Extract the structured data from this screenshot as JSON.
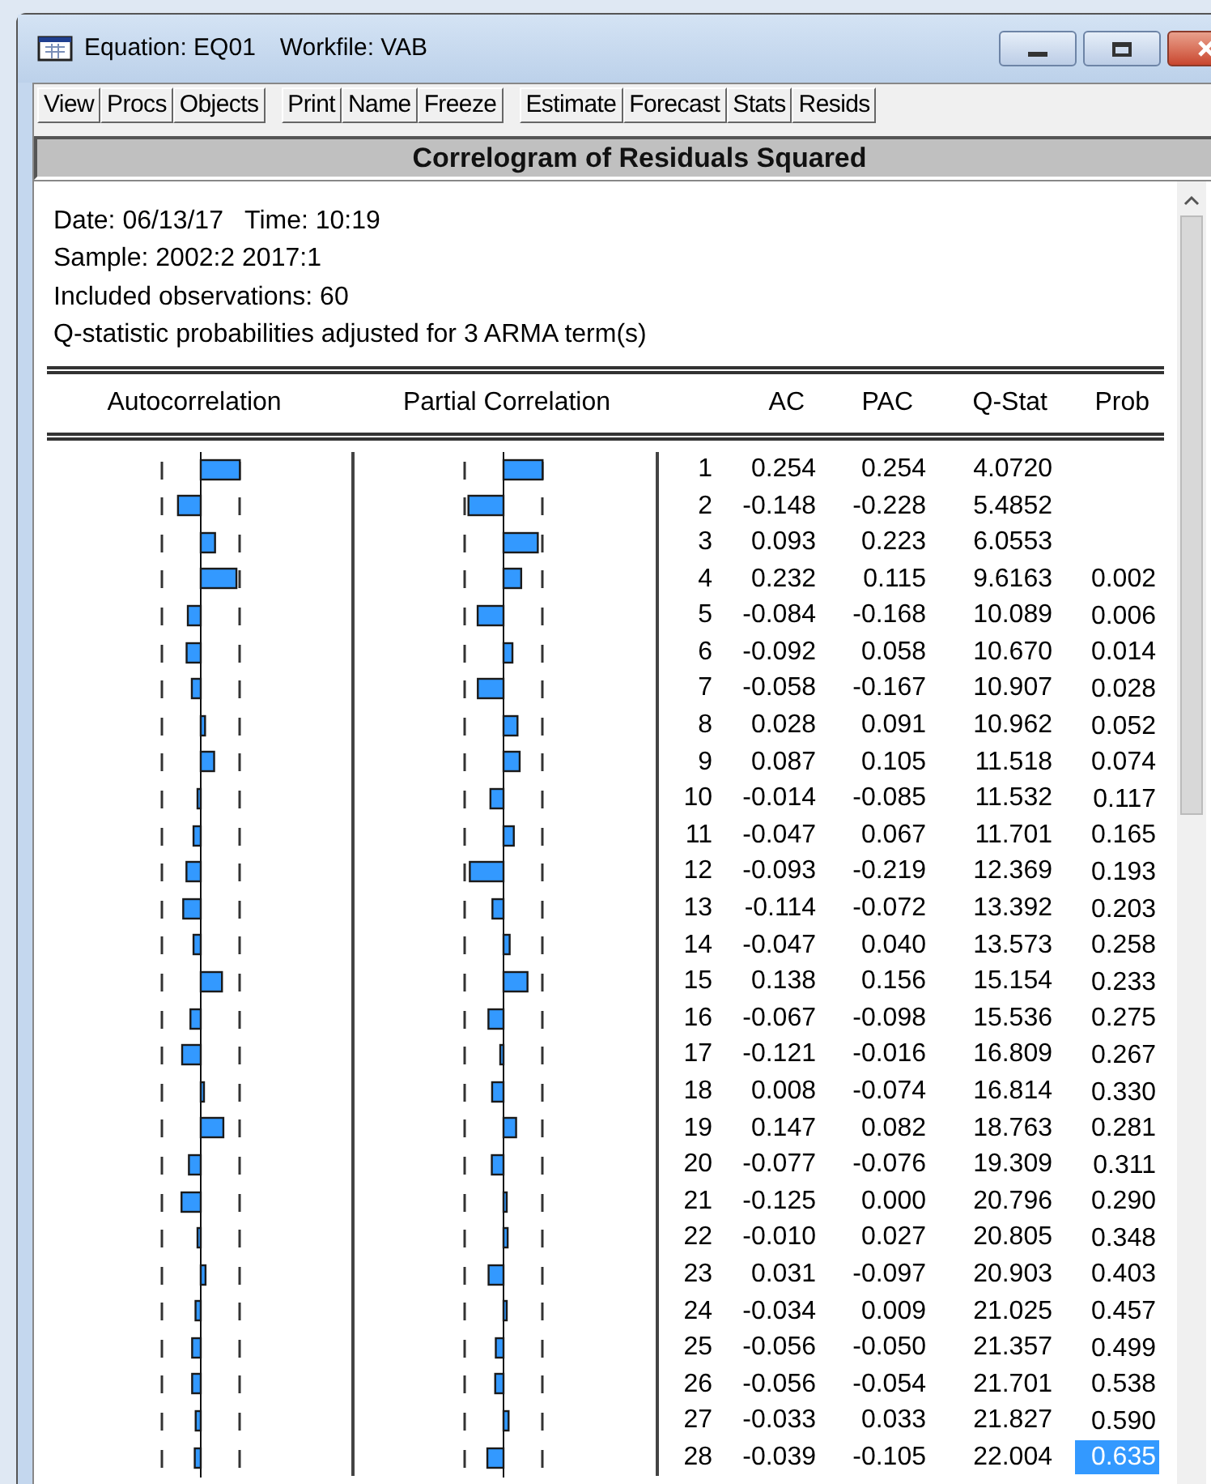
{
  "window": {
    "title": "Equation: EQ01",
    "workfile": "Workfile: VAB"
  },
  "toolbar_groups": [
    {
      "buttons": [
        "View",
        "Procs",
        "Objects"
      ]
    },
    {
      "buttons": [
        "Print",
        "Name",
        "Freeze"
      ]
    },
    {
      "buttons": [
        "Estimate",
        "Forecast",
        "Stats",
        "Resids"
      ]
    }
  ],
  "view_title": "Correlogram of Residuals Squared",
  "info_lines": [
    "Date: 06/13/17   Time: 10:19",
    "Sample: 2002:2 2017:1",
    "Included observations: 60",
    "Q-statistic probabilities adjusted for 3 ARMA term(s)"
  ],
  "columns": [
    "Autocorrelation",
    "Partial Correlation",
    "AC",
    "PAC",
    "Q-Stat",
    "Prob"
  ],
  "rows": [
    {
      "lag": "1",
      "ac": "0.254",
      "pac": "0.254",
      "q_stat": "4.0720",
      "selected": false
    },
    {
      "lag": "2",
      "ac": "-0.148",
      "pac": "-0.228",
      "q_stat": "5.4852",
      "selected": false
    },
    {
      "lag": "3",
      "ac": "0.093",
      "pac": "0.223",
      "q_stat": "6.0553",
      "selected": false
    },
    {
      "lag": "4",
      "ac": "0.232",
      "pac": "0.115",
      "q_stat": "9.6163",
      "prob": "0.002",
      "selected": false
    },
    {
      "lag": "5",
      "ac": "-0.084",
      "pac": "-0.168",
      "q_stat": "10.089",
      "prob": "0.006",
      "selected": false
    },
    {
      "lag": "6",
      "ac": "-0.092",
      "pac": "0.058",
      "q_stat": "10.670",
      "prob": "0.014",
      "selected": false
    },
    {
      "lag": "7",
      "ac": "-0.058",
      "pac": "-0.167",
      "q_stat": "10.907",
      "prob": "0.028",
      "selected": false
    },
    {
      "lag": "8",
      "ac": "0.028",
      "pac": "0.091",
      "q_stat": "10.962",
      "prob": "0.052",
      "selected": false
    },
    {
      "lag": "9",
      "ac": "0.087",
      "pac": "0.105",
      "q_stat": "11.518",
      "prob": "0.074",
      "selected": false
    },
    {
      "lag": "10",
      "ac": "-0.014",
      "pac": "-0.085",
      "q_stat": "11.532",
      "prob": "0.117",
      "selected": false
    },
    {
      "lag": "11",
      "ac": "-0.047",
      "pac": "0.067",
      "q_stat": "11.701",
      "prob": "0.165",
      "selected": false
    },
    {
      "lag": "12",
      "ac": "-0.093",
      "pac": "-0.219",
      "q_stat": "12.369",
      "prob": "0.193",
      "selected": false
    },
    {
      "lag": "13",
      "ac": "-0.114",
      "pac": "-0.072",
      "q_stat": "13.392",
      "prob": "0.203",
      "selected": false
    },
    {
      "lag": "14",
      "ac": "-0.047",
      "pac": "0.040",
      "q_stat": "13.573",
      "prob": "0.258",
      "selected": false
    },
    {
      "lag": "15",
      "ac": "0.138",
      "pac": "0.156",
      "q_stat": "15.154",
      "prob": "0.233",
      "selected": false
    },
    {
      "lag": "16",
      "ac": "-0.067",
      "pac": "-0.098",
      "q_stat": "15.536",
      "prob": "0.275",
      "selected": false
    },
    {
      "lag": "17",
      "ac": "-0.121",
      "pac": "-0.016",
      "q_stat": "16.809",
      "prob": "0.267",
      "selected": false
    },
    {
      "lag": "18",
      "ac": "0.008",
      "pac": "-0.074",
      "q_stat": "16.814",
      "prob": "0.330",
      "selected": false
    },
    {
      "lag": "19",
      "ac": "0.147",
      "pac": "0.082",
      "q_stat": "18.763",
      "prob": "0.281",
      "selected": false
    },
    {
      "lag": "20",
      "ac": "-0.077",
      "pac": "-0.076",
      "q_stat": "19.309",
      "prob": "0.311",
      "selected": false
    },
    {
      "lag": "21",
      "ac": "-0.125",
      "pac": "0.000",
      "q_stat": "20.796",
      "prob": "0.290",
      "selected": false
    },
    {
      "lag": "22",
      "ac": "-0.010",
      "pac": "0.027",
      "q_stat": "20.805",
      "prob": "0.348",
      "selected": false
    },
    {
      "lag": "23",
      "ac": "0.031",
      "pac": "-0.097",
      "q_stat": "20.903",
      "prob": "0.403",
      "selected": false
    },
    {
      "lag": "24",
      "ac": "-0.034",
      "pac": "0.009",
      "q_stat": "21.025",
      "prob": "0.457",
      "selected": false
    },
    {
      "lag": "25",
      "ac": "-0.056",
      "pac": "-0.050",
      "q_stat": "21.357",
      "prob": "0.499",
      "selected": false
    },
    {
      "lag": "26",
      "ac": "-0.056",
      "pac": "-0.054",
      "q_stat": "21.701",
      "prob": "0.538",
      "selected": false
    },
    {
      "lag": "27",
      "ac": "-0.033",
      "pac": "0.033",
      "q_stat": "21.827",
      "prob": "0.590",
      "selected": false
    },
    {
      "lag": "28",
      "ac": "-0.039",
      "pac": "-0.105",
      "q_stat": "22.004",
      "prob": "0.635",
      "selected": true
    }
  ]
}
